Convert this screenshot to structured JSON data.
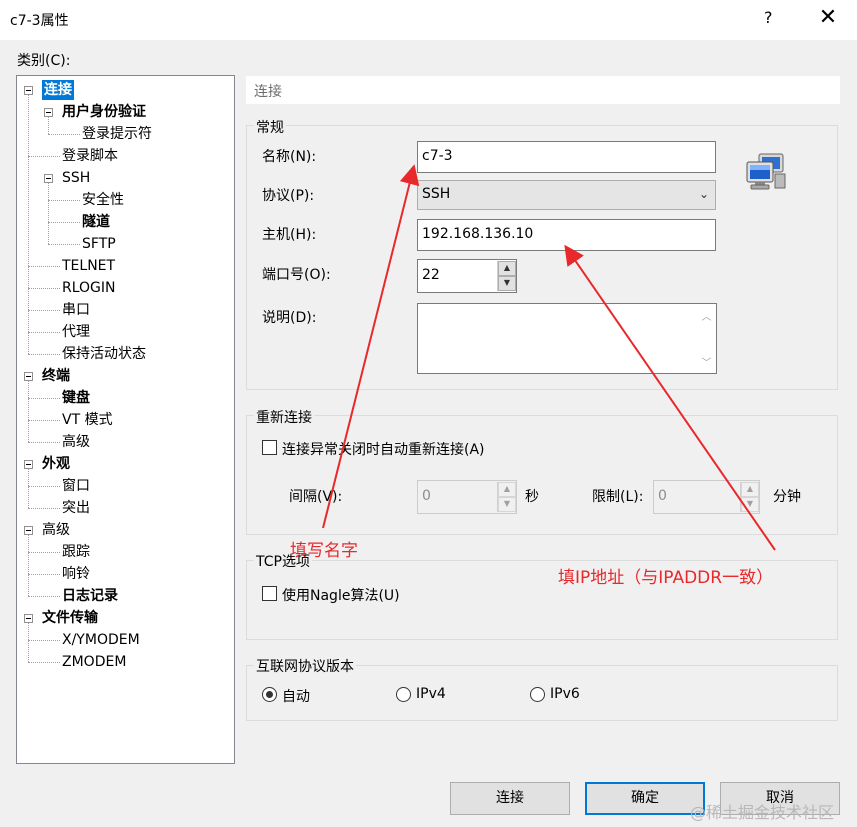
{
  "window": {
    "title": "c7-3属性",
    "help": "?",
    "close": "✕"
  },
  "category_label": "类别(C):",
  "tree": [
    {
      "label": "连接",
      "level": 0,
      "bold": true,
      "selected": true,
      "expander": true,
      "name": "tree-item-connection"
    },
    {
      "label": "用户身份验证",
      "level": 1,
      "bold": true,
      "expander": true,
      "name": "tree-item-user-auth"
    },
    {
      "label": "登录提示符",
      "level": 2,
      "name": "tree-item-login-prompt"
    },
    {
      "label": "登录脚本",
      "level": 1,
      "name": "tree-item-login-script"
    },
    {
      "label": "SSH",
      "level": 1,
      "expander": true,
      "name": "tree-item-ssh"
    },
    {
      "label": "安全性",
      "level": 2,
      "name": "tree-item-security"
    },
    {
      "label": "隧道",
      "level": 2,
      "bold": true,
      "name": "tree-item-tunnel"
    },
    {
      "label": "SFTP",
      "level": 2,
      "name": "tree-item-sftp"
    },
    {
      "label": "TELNET",
      "level": 1,
      "name": "tree-item-telnet"
    },
    {
      "label": "RLOGIN",
      "level": 1,
      "name": "tree-item-rlogin"
    },
    {
      "label": "串口",
      "level": 1,
      "name": "tree-item-serial"
    },
    {
      "label": "代理",
      "level": 1,
      "name": "tree-item-proxy"
    },
    {
      "label": "保持活动状态",
      "level": 1,
      "name": "tree-item-keepalive"
    },
    {
      "label": "终端",
      "level": 0,
      "bold": true,
      "expander": true,
      "name": "tree-item-terminal"
    },
    {
      "label": "键盘",
      "level": 1,
      "bold": true,
      "name": "tree-item-keyboard"
    },
    {
      "label": "VT 模式",
      "level": 1,
      "name": "tree-item-vt-mode"
    },
    {
      "label": "高级",
      "level": 1,
      "name": "tree-item-terminal-advanced"
    },
    {
      "label": "外观",
      "level": 0,
      "bold": true,
      "expander": true,
      "name": "tree-item-appearance"
    },
    {
      "label": "窗口",
      "level": 1,
      "name": "tree-item-window"
    },
    {
      "label": "突出",
      "level": 1,
      "name": "tree-item-highlight"
    },
    {
      "label": "高级",
      "level": 0,
      "expander": true,
      "name": "tree-item-advanced"
    },
    {
      "label": "跟踪",
      "level": 1,
      "name": "tree-item-trace"
    },
    {
      "label": "响铃",
      "level": 1,
      "name": "tree-item-bell"
    },
    {
      "label": "日志记录",
      "level": 1,
      "bold": true,
      "name": "tree-item-logging"
    },
    {
      "label": "文件传输",
      "level": 0,
      "bold": true,
      "expander": true,
      "name": "tree-item-file-transfer"
    },
    {
      "label": "X/YMODEM",
      "level": 1,
      "name": "tree-item-xymodem"
    },
    {
      "label": "ZMODEM",
      "level": 1,
      "name": "tree-item-zmodem"
    }
  ],
  "panel": {
    "header": "连接",
    "general": {
      "title": "常规",
      "name_label": "名称(N):",
      "name_value": "c7-3",
      "protocol_label": "协议(P):",
      "protocol_value": "SSH",
      "host_label": "主机(H):",
      "host_value": "192.168.136.10",
      "port_label": "端口号(O):",
      "port_value": "22",
      "desc_label": "说明(D):",
      "desc_value": ""
    },
    "reconnect": {
      "title": "重新连接",
      "auto_label": "连接异常关闭时自动重新连接(A)",
      "auto_checked": false,
      "interval_label": "间隔(V):",
      "interval_value": "0",
      "interval_unit": "秒",
      "limit_label": "限制(L):",
      "limit_value": "0",
      "limit_unit": "分钟"
    },
    "tcp": {
      "title": "TCP选项",
      "nagle_label": "使用Nagle算法(U)",
      "nagle_checked": false
    },
    "ip": {
      "title": "互联网协议版本",
      "options": [
        "自动",
        "IPv4",
        "IPv6"
      ],
      "selected": "自动"
    }
  },
  "buttons": {
    "connect": "连接",
    "ok": "确定",
    "cancel": "取消"
  },
  "annotations": {
    "fill_name": "填写名字",
    "fill_ip": "填IP地址（与IPADDR一致）",
    "color": "#e8282b"
  },
  "watermark": "@稀土掘金技术社区",
  "icons": {
    "connection": "network-computers-icon",
    "spin_up": "▲",
    "spin_down": "▼",
    "dropdown": "⌄",
    "scroll_up": "︿",
    "scroll_down": "﹀"
  }
}
